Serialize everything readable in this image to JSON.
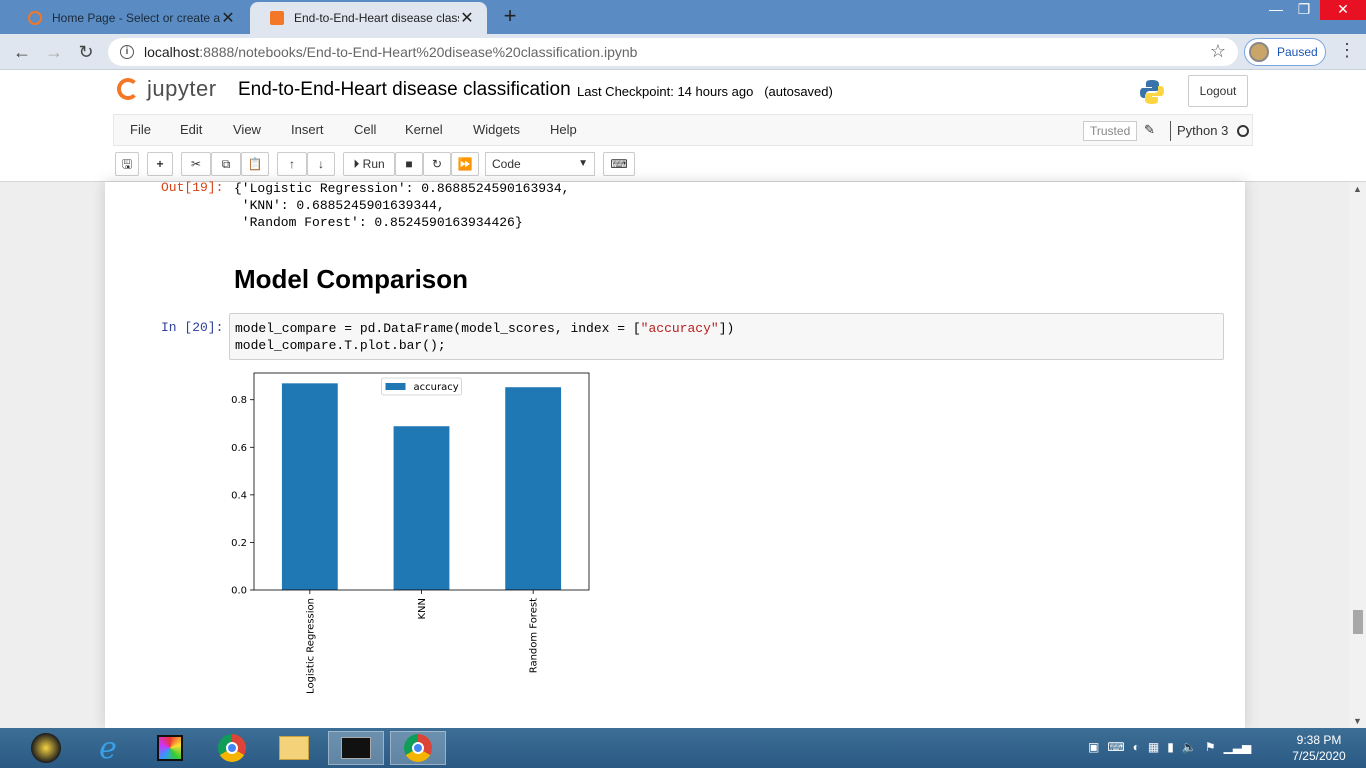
{
  "browser": {
    "tabs": [
      {
        "title": "Home Page - Select or create a n",
        "active": false
      },
      {
        "title": "End-to-End-Heart disease classifi",
        "active": true
      }
    ],
    "url_host": "localhost",
    "url_path": ":8888/notebooks/End-to-End-Heart%20disease%20classification.ipynb",
    "profile_label": "Paused"
  },
  "jupyter": {
    "logo_text": "jupyter",
    "title": "End-to-End-Heart disease classification",
    "checkpoint": "Last Checkpoint: 14 hours ago",
    "autosaved": "(autosaved)",
    "logout": "Logout",
    "menu": [
      "File",
      "Edit",
      "View",
      "Insert",
      "Cell",
      "Kernel",
      "Widgets",
      "Help"
    ],
    "trusted": "Trusted",
    "kernel": "Python 3",
    "run_label": "Run",
    "cell_type": "Code"
  },
  "notebook": {
    "out_prompt": "Out[19]:",
    "out_lines": [
      "{'Logistic Regression': 0.8688524590163934,",
      " 'KNN': 0.6885245901639344,",
      " 'Random Forest': 0.8524590163934426}"
    ],
    "heading": "Model Comparison",
    "in_prompt": "In [20]:",
    "code_line1_a": "model_compare = pd.DataFrame(model_scores, index = [",
    "code_line1_str": "\"accuracy\"",
    "code_line1_b": "])",
    "code_line2": "model_compare.T.plot.bar();"
  },
  "chart_data": {
    "type": "bar",
    "categories": [
      "Logistic Regression",
      "KNN",
      "Random Forest"
    ],
    "series": [
      {
        "name": "accuracy",
        "values": [
          0.8688524590163934,
          0.6885245901639344,
          0.8524590163934426
        ]
      }
    ],
    "yticks": [
      "0.0",
      "0.2",
      "0.4",
      "0.6",
      "0.8"
    ],
    "ylim": [
      0,
      0.9122950819672131
    ],
    "legend": "top-center",
    "color": "#1f77b4"
  },
  "taskbar": {
    "time": "9:38 PM",
    "date": "7/25/2020"
  }
}
